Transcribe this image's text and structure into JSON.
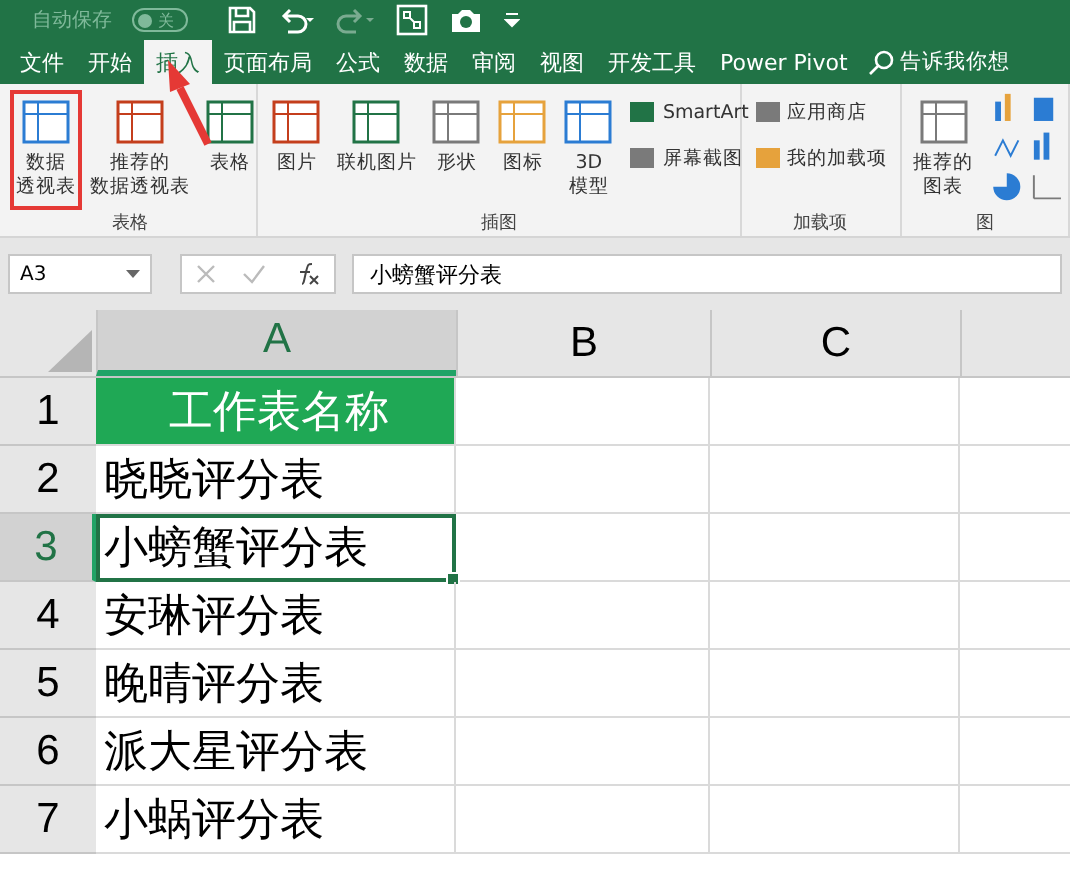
{
  "title_bar": {
    "autosave_label": "自动保存",
    "autosave": {
      "on": false,
      "state_label": "关"
    },
    "redo_disabled": true
  },
  "tabs": [
    {
      "label": "文件",
      "selected": false
    },
    {
      "label": "开始",
      "selected": false
    },
    {
      "label": "插入",
      "selected": true
    },
    {
      "label": "页面布局",
      "selected": false
    },
    {
      "label": "公式",
      "selected": false
    },
    {
      "label": "数据",
      "selected": false
    },
    {
      "label": "审阅",
      "selected": false
    },
    {
      "label": "视图",
      "selected": false
    },
    {
      "label": "开发工具",
      "selected": false
    },
    {
      "label": "Power Pivot",
      "selected": false
    }
  ],
  "search": {
    "placeholder": "告诉我你想"
  },
  "ribbon": {
    "groups": [
      {
        "label": "表格",
        "items": [
          {
            "kind": "large",
            "lines": [
              "数据",
              "透视表"
            ],
            "highlighted": true
          },
          {
            "kind": "large",
            "lines": [
              "推荐的",
              "数据透视表"
            ],
            "highlighted": false
          },
          {
            "kind": "large",
            "lines": [
              "表格"
            ],
            "highlighted": false
          }
        ]
      },
      {
        "label": "插图",
        "items": [
          {
            "kind": "large",
            "lines": [
              "图片"
            ],
            "highlighted": false
          },
          {
            "kind": "large",
            "lines": [
              "联机图片"
            ],
            "highlighted": false
          },
          {
            "kind": "large",
            "lines": [
              "形状"
            ],
            "highlighted": false
          },
          {
            "kind": "large",
            "lines": [
              "图标"
            ],
            "highlighted": false
          },
          {
            "kind": "large",
            "lines": [
              "3D",
              "模型"
            ],
            "highlighted": false
          },
          {
            "kind": "small",
            "lines": [
              "SmartArt"
            ]
          },
          {
            "kind": "small",
            "lines": [
              "屏幕截图"
            ]
          }
        ]
      },
      {
        "label": "加载项",
        "items": [
          {
            "kind": "small",
            "lines": [
              "应用商店"
            ]
          },
          {
            "kind": "small",
            "lines": [
              "我的加载项"
            ]
          }
        ]
      },
      {
        "label": "图",
        "items": [
          {
            "kind": "large",
            "lines": [
              "推荐的",
              "图表"
            ],
            "highlighted": false
          },
          {
            "kind": "charts"
          }
        ]
      }
    ]
  },
  "formula_bar": {
    "name_box": "A3",
    "value": "小螃蟹评分表"
  },
  "sheet": {
    "columns": [
      {
        "label": "A",
        "selected": true
      },
      {
        "label": "B",
        "selected": false
      },
      {
        "label": "C",
        "selected": false
      }
    ],
    "rows": [
      {
        "number": "1",
        "kind": "header",
        "value": "工作表名称",
        "selected": false
      },
      {
        "number": "2",
        "kind": "data",
        "value": "晓晓评分表",
        "selected": false
      },
      {
        "number": "3",
        "kind": "data",
        "value": "小螃蟹评分表",
        "selected": true
      },
      {
        "number": "4",
        "kind": "data",
        "value": "安琳评分表",
        "selected": false
      },
      {
        "number": "5",
        "kind": "data",
        "value": "晚晴评分表",
        "selected": false
      },
      {
        "number": "6",
        "kind": "data",
        "value": "派大星评分表",
        "selected": false
      },
      {
        "number": "7",
        "kind": "data",
        "value": "小蜗评分表",
        "selected": false
      }
    ]
  }
}
